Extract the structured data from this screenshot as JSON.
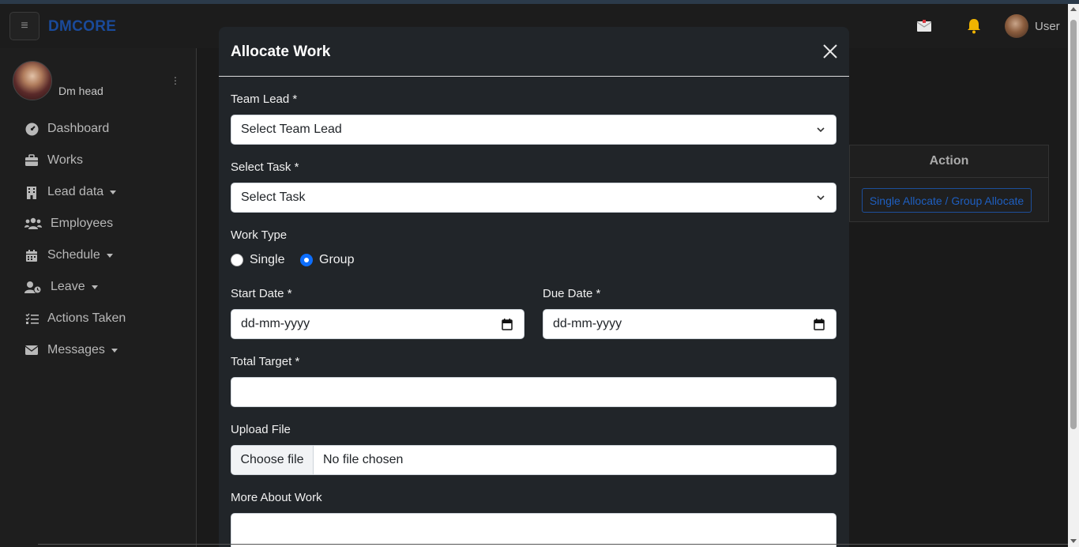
{
  "app": {
    "brand": "DMCORE"
  },
  "navbar": {
    "user_label": "User"
  },
  "sidebar": {
    "profile_name": "Dm head",
    "items": [
      {
        "label": "Dashboard",
        "icon": "dashboard-icon",
        "has_caret": false
      },
      {
        "label": "Works",
        "icon": "briefcase-icon",
        "has_caret": false
      },
      {
        "label": "Lead data",
        "icon": "building-icon",
        "has_caret": true
      },
      {
        "label": "Employees",
        "icon": "users-icon",
        "has_caret": false
      },
      {
        "label": "Schedule",
        "icon": "calendar-icon",
        "has_caret": true
      },
      {
        "label": "Leave",
        "icon": "user-clock-icon",
        "has_caret": true
      },
      {
        "label": "Actions Taken",
        "icon": "list-check-icon",
        "has_caret": false
      },
      {
        "label": "Messages",
        "icon": "envelope-icon",
        "has_caret": true
      }
    ]
  },
  "background_table": {
    "header_action": "Action",
    "row_button": "Single Allocate / Group Allocate"
  },
  "modal": {
    "title": "Allocate Work",
    "team_lead": {
      "label": "Team Lead *",
      "value": "Select Team Lead"
    },
    "task": {
      "label": "Select Task *",
      "value": "Select Task"
    },
    "work_type": {
      "label": "Work Type",
      "options": [
        "Single",
        "Group"
      ],
      "selected": "Group"
    },
    "start_date": {
      "label": "Start Date *",
      "placeholder": "dd-mm-yyyy"
    },
    "due_date": {
      "label": "Due Date *",
      "placeholder": "dd-mm-yyyy"
    },
    "total_target": {
      "label": "Total Target *",
      "value": ""
    },
    "upload_file": {
      "label": "Upload File",
      "button": "Choose file",
      "status": "No file chosen"
    },
    "more_about": {
      "label": "More About Work",
      "value": ""
    }
  }
}
